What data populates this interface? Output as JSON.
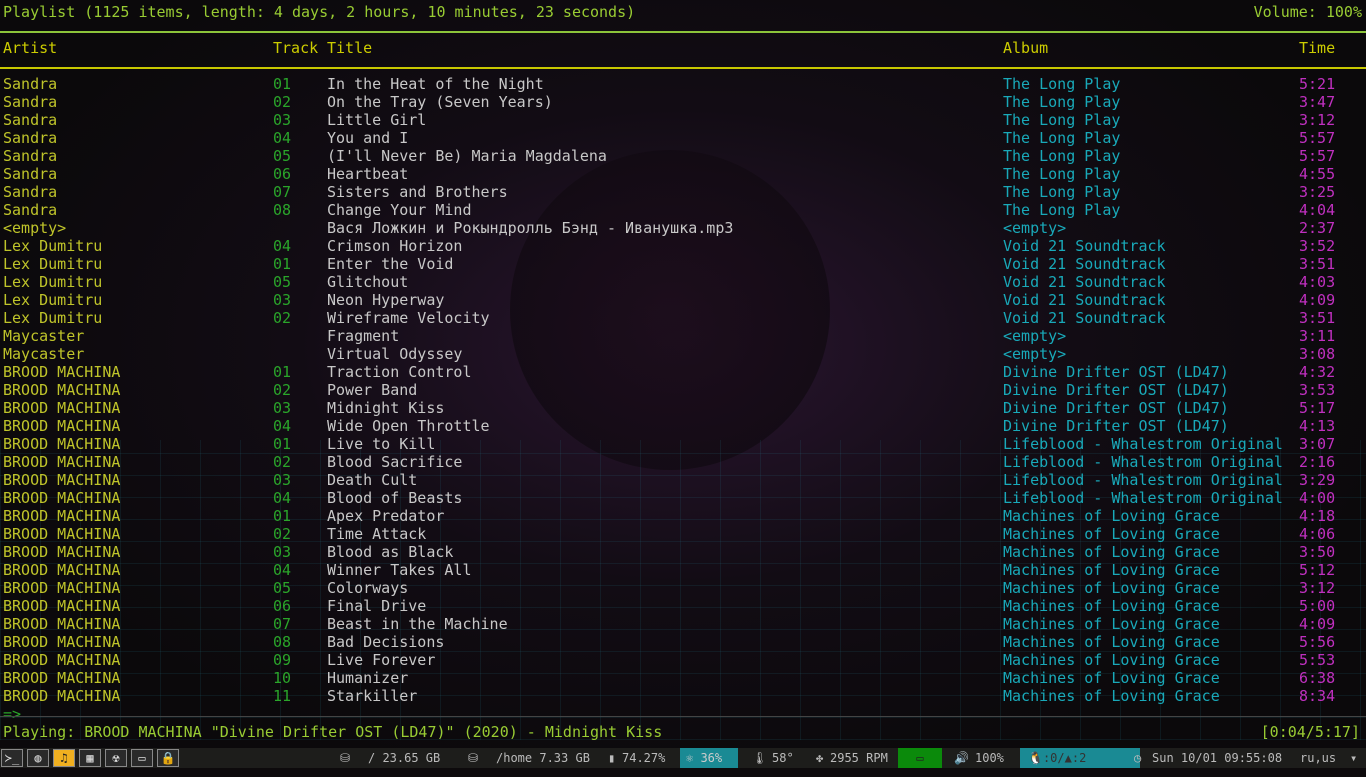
{
  "header": {
    "title": "Playlist (1125 items, length: 4 days, 2 hours, 10 minutes, 23 seconds)",
    "volume": "Volume: 100%"
  },
  "columns": {
    "artist": "Artist",
    "track": "Track",
    "title": "Title",
    "album": "Album",
    "time": "Time"
  },
  "rows": [
    [
      "Sandra",
      "01",
      "In the Heat of the Night",
      "The Long Play",
      "5:21"
    ],
    [
      "Sandra",
      "02",
      "On the Tray (Seven Years)",
      "The Long Play",
      "3:47"
    ],
    [
      "Sandra",
      "03",
      "Little Girl",
      "The Long Play",
      "3:12"
    ],
    [
      "Sandra",
      "04",
      "You and I",
      "The Long Play",
      "5:57"
    ],
    [
      "Sandra",
      "05",
      "(I'll Never Be) Maria Magdalena",
      "The Long Play",
      "5:57"
    ],
    [
      "Sandra",
      "06",
      "Heartbeat",
      "The Long Play",
      "4:55"
    ],
    [
      "Sandra",
      "07",
      "Sisters and Brothers",
      "The Long Play",
      "3:25"
    ],
    [
      "Sandra",
      "08",
      "Change Your Mind",
      "The Long Play",
      "4:04"
    ],
    [
      "<empty>",
      "",
      "Вася Ложкин и Рокындролль Бэнд - Иванушка.mp3",
      "<empty>",
      "2:37"
    ],
    [
      "Lex Dumitru",
      "04",
      "Crimson Horizon",
      "Void 21 Soundtrack",
      "3:52"
    ],
    [
      "Lex Dumitru",
      "01",
      "Enter the Void",
      "Void 21 Soundtrack",
      "3:51"
    ],
    [
      "Lex Dumitru",
      "05",
      "Glitchout",
      "Void 21 Soundtrack",
      "4:03"
    ],
    [
      "Lex Dumitru",
      "03",
      "Neon Hyperway",
      "Void 21 Soundtrack",
      "4:09"
    ],
    [
      "Lex Dumitru",
      "02",
      "Wireframe Velocity",
      "Void 21 Soundtrack",
      "3:51"
    ],
    [
      "Maycaster",
      "",
      "Fragment",
      "<empty>",
      "3:11"
    ],
    [
      "Maycaster",
      "",
      "Virtual Odyssey",
      "<empty>",
      "3:08"
    ],
    [
      "BROOD MACHINA",
      "01",
      "Traction Control",
      "Divine Drifter OST (LD47)",
      "4:32"
    ],
    [
      "BROOD MACHINA",
      "02",
      "Power Band",
      "Divine Drifter OST (LD47)",
      "3:53"
    ],
    [
      "BROOD MACHINA",
      "03",
      "Midnight Kiss",
      "Divine Drifter OST (LD47)",
      "5:17"
    ],
    [
      "BROOD MACHINA",
      "04",
      "Wide Open Throttle",
      "Divine Drifter OST (LD47)",
      "4:13"
    ],
    [
      "BROOD MACHINA",
      "01",
      "Live to Kill",
      "Lifeblood - Whalestrom Original",
      "3:07"
    ],
    [
      "BROOD MACHINA",
      "02",
      "Blood Sacrifice",
      "Lifeblood - Whalestrom Original",
      "2:16"
    ],
    [
      "BROOD MACHINA",
      "03",
      "Death Cult",
      "Lifeblood - Whalestrom Original",
      "3:29"
    ],
    [
      "BROOD MACHINA",
      "04",
      "Blood of Beasts",
      "Lifeblood - Whalestrom Original",
      "4:00"
    ],
    [
      "BROOD MACHINA",
      "01",
      "Apex Predator",
      "Machines of Loving Grace",
      "4:18"
    ],
    [
      "BROOD MACHINA",
      "02",
      "Time Attack",
      "Machines of Loving Grace",
      "4:06"
    ],
    [
      "BROOD MACHINA",
      "03",
      "Blood as Black",
      "Machines of Loving Grace",
      "3:50"
    ],
    [
      "BROOD MACHINA",
      "04",
      "Winner Takes All",
      "Machines of Loving Grace",
      "5:12"
    ],
    [
      "BROOD MACHINA",
      "05",
      "Colorways",
      "Machines of Loving Grace",
      "3:12"
    ],
    [
      "BROOD MACHINA",
      "06",
      "Final Drive",
      "Machines of Loving Grace",
      "5:00"
    ],
    [
      "BROOD MACHINA",
      "07",
      "Beast in the Machine",
      "Machines of Loving Grace",
      "4:09"
    ],
    [
      "BROOD MACHINA",
      "08",
      "Bad Decisions",
      "Machines of Loving Grace",
      "5:56"
    ],
    [
      "BROOD MACHINA",
      "09",
      "Live Forever",
      "Machines of Loving Grace",
      "5:53"
    ],
    [
      "BROOD MACHINA",
      "10",
      "Humanizer",
      "Machines of Loving Grace",
      "6:38"
    ],
    [
      "BROOD MACHINA",
      "11",
      "Starkiller",
      "Machines of Loving Grace",
      "8:34"
    ]
  ],
  "prompt": "=>",
  "playing": "Playing: BROOD MACHINA \"Divine Drifter OST (LD47)\" (2020) - Midnight Kiss",
  "position": "[0:04/5:17]",
  "statusbar": {
    "workspaces": [
      "terminal",
      "browser",
      "music",
      "video",
      "radiation",
      "desktop",
      "lock"
    ],
    "workspace_glyphs": [
      "≻_",
      "◍",
      "♫",
      "▦",
      "☢",
      "▭",
      "🔒"
    ],
    "root_disk": "/ 23.65 GB",
    "home_disk": "/home 7.33 GB",
    "battery": "74.27%",
    "cpu": "36%",
    "temp": "58°",
    "fan": "2955 RPM",
    "volume": "100%",
    "updates": ":0/",
    "arch": ":2",
    "clock": "Sun 10/01 09:55:08",
    "layout": "ru,us"
  }
}
